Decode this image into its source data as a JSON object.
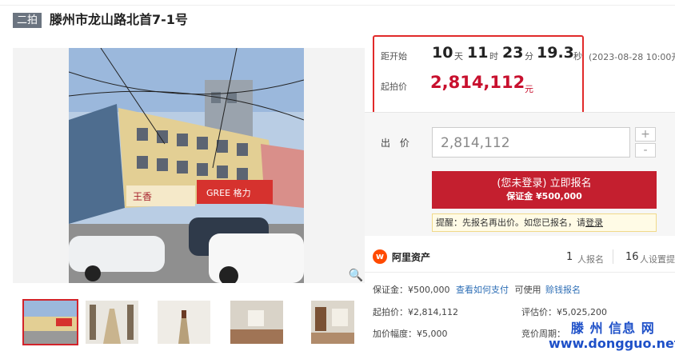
{
  "header": {
    "round_badge": "二拍",
    "title": "滕州市龙山路北首7-1号"
  },
  "countdown": {
    "label": "距开始",
    "days": "10",
    "days_unit": "天",
    "hours": "11",
    "hours_unit": "时",
    "minutes": "23",
    "minutes_unit": "分",
    "seconds": "19.3",
    "seconds_unit": "秒",
    "start_time": "(2023-08-28 10:00开"
  },
  "price": {
    "label": "起拍价",
    "value": "2,814,112",
    "unit": "元"
  },
  "bid": {
    "label": "出 价",
    "value": "2,814,112",
    "plus": "+",
    "minus": "-"
  },
  "signup": {
    "main": "(您未登录) 立即报名",
    "deposit": "保证金 ¥500,000"
  },
  "notice": {
    "prefix": "提醒：先报名再出价。如您已报名，请",
    "login": "登录"
  },
  "platform": {
    "logo_glyph": "w",
    "name": "阿里资产",
    "signups_count": "1",
    "signups_label": "人报名",
    "reminders_count": "16",
    "reminders_label": "人设置提"
  },
  "details": {
    "deposit": "保证金：¥500,000",
    "how_to_pay": "查看如何支付",
    "can_use": "可使用",
    "credit_signup": "赊钱报名",
    "start_price": "起拍价：¥2,814,112",
    "appraisal": "评估价：¥5,025,200",
    "increment": "加价幅度：¥5,000",
    "auction_period": "竞价周期："
  },
  "photo": {
    "sign_left": "王香",
    "sign_brand": "GREE 格力"
  },
  "watermark": {
    "line1": "滕 州 信息 网",
    "line2": "www.dongguo.net"
  },
  "icons": {
    "zoom": "magnifier-icon",
    "logo": "ali-assets-logo-icon"
  },
  "colors": {
    "accent_red": "#c41f2f",
    "countdown_border": "#e12a2a",
    "link_blue": "#2f6fb6"
  }
}
